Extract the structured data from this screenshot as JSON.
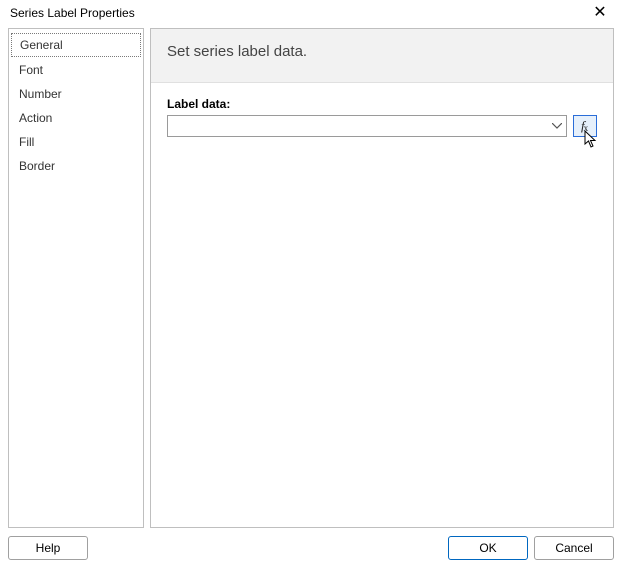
{
  "window": {
    "title": "Series Label Properties"
  },
  "sidebar": {
    "items": [
      {
        "label": "General",
        "selected": true
      },
      {
        "label": "Font",
        "selected": false
      },
      {
        "label": "Number",
        "selected": false
      },
      {
        "label": "Action",
        "selected": false
      },
      {
        "label": "Fill",
        "selected": false
      },
      {
        "label": "Border",
        "selected": false
      }
    ]
  },
  "panel": {
    "heading": "Set series label data.",
    "label_data_label": "Label data:",
    "label_data_value": "",
    "fx_symbol": "f",
    "fx_sub": "x"
  },
  "footer": {
    "help": "Help",
    "ok": "OK",
    "cancel": "Cancel"
  }
}
